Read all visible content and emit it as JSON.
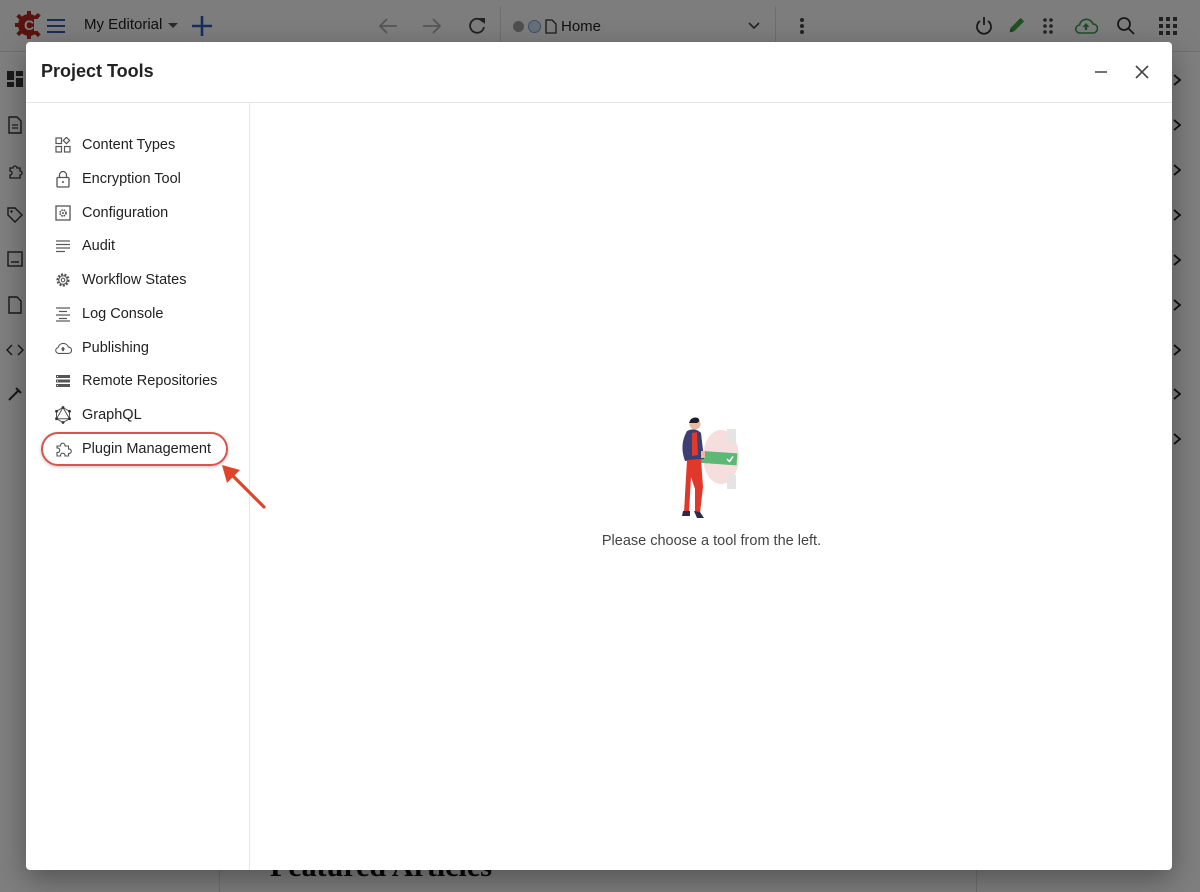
{
  "topbar": {
    "logo_icon": "crafter-gear-logo",
    "menu_icon": "hamburger-icon",
    "site_name": "My Editorial",
    "add_icon": "plus-icon",
    "back_icon": "arrow-left-icon",
    "forward_icon": "arrow-right-icon",
    "reload_icon": "reload-icon",
    "address": {
      "status_icon": "status-dot",
      "info_icon": "info-icon",
      "page_icon": "file-icon",
      "page_name": "Home",
      "dropdown_icon": "chevron-down-icon"
    },
    "more_icon": "kebab-icon",
    "right_icons": [
      "power-icon",
      "pencil-icon",
      "drag-dots-icon",
      "cloud-upload-icon",
      "search-icon",
      "apps-grid-icon"
    ]
  },
  "background": {
    "rail_icons": [
      "dashboard-icon",
      "document-icon",
      "puzzle-icon",
      "tag-icon",
      "image-icon",
      "file-icon",
      "code-icon",
      "tools-icon"
    ],
    "heading_partial": "Featured Articles"
  },
  "dialog": {
    "title": "Project Tools",
    "minimize_icon": "minimize-icon",
    "close_icon": "close-icon",
    "tools": [
      {
        "label": "Content Types",
        "icon": "content-types-icon"
      },
      {
        "label": "Encryption Tool",
        "icon": "lock-icon"
      },
      {
        "label": "Configuration",
        "icon": "settings-box-icon"
      },
      {
        "label": "Audit",
        "icon": "lines-icon"
      },
      {
        "label": "Workflow States",
        "icon": "gear-icon"
      },
      {
        "label": "Log Console",
        "icon": "align-center-icon"
      },
      {
        "label": "Publishing",
        "icon": "cloud-upload-icon"
      },
      {
        "label": "Remote Repositories",
        "icon": "storage-list-icon"
      },
      {
        "label": "GraphQL",
        "icon": "graphql-icon"
      },
      {
        "label": "Plugin Management",
        "icon": "puzzle-icon",
        "highlighted": true
      }
    ],
    "empty_state": {
      "illustration": "person-choosing-illustration",
      "message": "Please choose a tool from the left."
    }
  },
  "annotation": {
    "color": "#d9534f",
    "target": "Plugin Management"
  },
  "colors": {
    "accent_blue": "#2f5bb7",
    "logo_red": "#b5261e",
    "cloud_green": "#3e9b4f",
    "pencil_green": "#43a047"
  }
}
